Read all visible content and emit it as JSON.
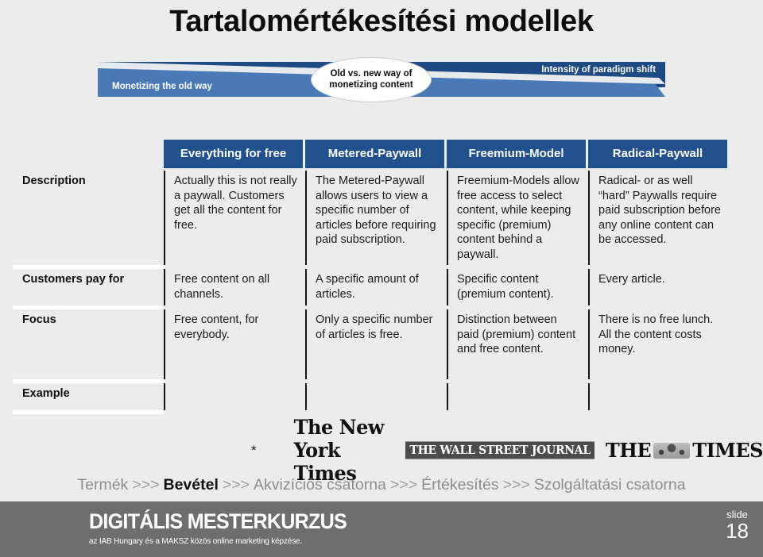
{
  "slide": {
    "title": "Tartalomértékesítési modellek",
    "number": "18",
    "number_label": "slide"
  },
  "banner": {
    "left_label": "Monetizing the old way",
    "right_label": "Intensity of paradigm shift",
    "callout_line1": "Old vs. new way of",
    "callout_line2": "monetizing content",
    "color_light": "#4a7ab6",
    "color_dark": "#1d4a82"
  },
  "matrix": {
    "header_color": "#21518d",
    "columns": [
      "Everything for free",
      "Metered-Paywall",
      "Freemium-Model",
      "Radical-Paywall"
    ],
    "rows": [
      {
        "label": "Description",
        "cells": [
          "Actually this is not really a paywall. Customers get all the content for free.",
          "The Metered-Paywall allows users to view a specific number of articles before requiring paid subscription.",
          "Freemium-Models allow free access to select content, while keeping specific (premium) content behind a paywall.",
          "Radical- or as well “hard” Paywalls require paid subscription before any online content can be accessed."
        ]
      },
      {
        "label": "Customers pay for",
        "cells": [
          "Free content on all channels.",
          "A specific amount of articles.",
          "Specific content (premium content).",
          "Every article."
        ]
      },
      {
        "label": "Focus",
        "cells": [
          "Free content, for everybody.",
          "Only a specific number of articles is free.",
          "Distinction between paid (premium) content and free content.",
          "There is no free lunch. All the content costs money."
        ]
      },
      {
        "label": "Example",
        "cells": [
          "",
          "",
          "",
          ""
        ]
      }
    ]
  },
  "examples": {
    "asterisk": "*",
    "logo_nyt": "The New York Times",
    "logo_wsj": "THE WALL STREET JOURNAL",
    "logo_times_prefix": "THE",
    "logo_times_suffix": "TIMES"
  },
  "breadcrumb": {
    "separator": ">>>",
    "items": [
      {
        "text": "Termék",
        "active": false
      },
      {
        "text": "Bevétel",
        "active": true
      },
      {
        "text": "Akvizíciós csatorna",
        "active": false
      },
      {
        "text": "Értékesítés",
        "active": false
      },
      {
        "text": "Szolgáltatási csatorna",
        "active": false
      }
    ]
  },
  "footer": {
    "brand_name": "DIGITÁLIS MESTERKURZUS",
    "brand_tagline": "az IAB Hungary és a MAKSZ közös online marketing képzése.",
    "background": "#6e6e6e"
  }
}
